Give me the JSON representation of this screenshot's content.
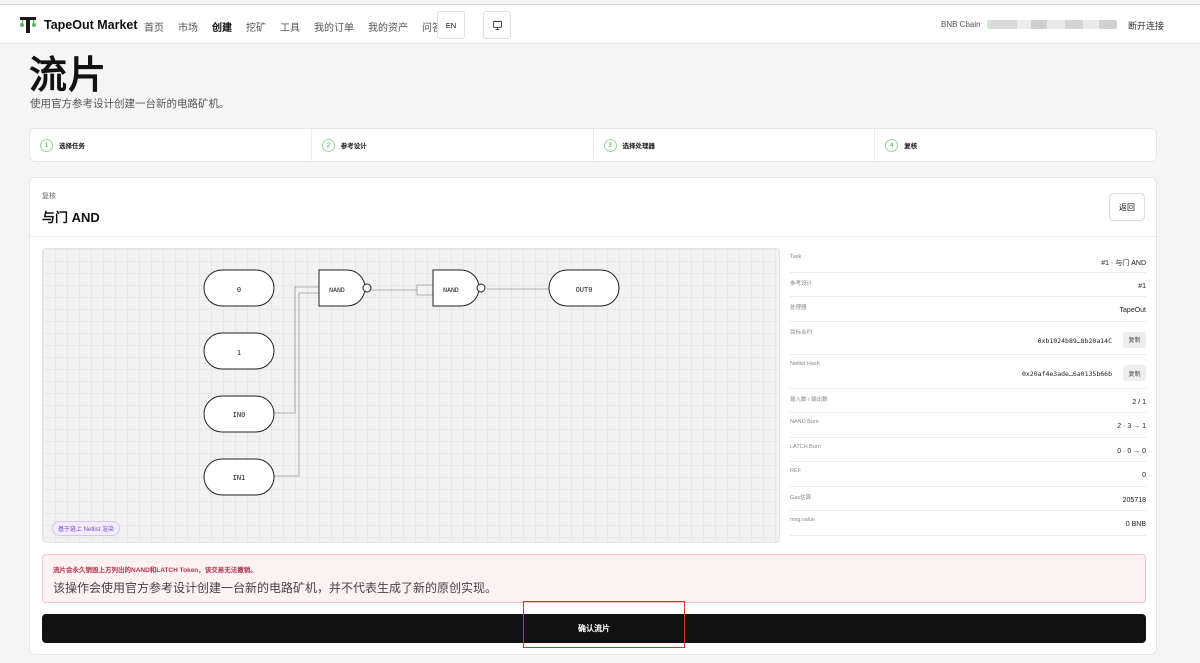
{
  "header": {
    "brand": "TapeOut Market",
    "nav": [
      "首页",
      "市场",
      "创建",
      "挖矿",
      "工具",
      "我的订单",
      "我的资产",
      "问答"
    ],
    "active_nav": "创建",
    "lang_label": "EN",
    "chain_label": "BNB Chain",
    "disconnect_label": "断开连接"
  },
  "page": {
    "title": "流片",
    "subtitle": "使用官方参考设计创建一台新的电路矿机。"
  },
  "steps": [
    {
      "num": "1",
      "label": "选择任务"
    },
    {
      "num": "2",
      "label": "参考设计"
    },
    {
      "num": "3",
      "label": "选择处理器"
    },
    {
      "num": "4",
      "label": "复核"
    }
  ],
  "review": {
    "kicker": "复核",
    "title": "与门 AND",
    "back_label": "返回"
  },
  "circuit": {
    "nodes": [
      {
        "id": "in-0",
        "label": "0",
        "type": "io"
      },
      {
        "id": "in-1",
        "label": "1",
        "type": "io"
      },
      {
        "id": "in-IN0",
        "label": "IN0",
        "type": "io"
      },
      {
        "id": "in-IN1",
        "label": "IN1",
        "type": "io"
      },
      {
        "id": "gate-1",
        "label": "NAND",
        "type": "nand"
      },
      {
        "id": "gate-2",
        "label": "NAND",
        "type": "nand"
      },
      {
        "id": "out-OUT0",
        "label": "OUT0",
        "type": "io"
      }
    ],
    "badge": "基于链上 Netlist 渲染"
  },
  "details": {
    "rows": [
      {
        "key": "Task",
        "value": "#1 · 与门 AND"
      },
      {
        "key": "参考设计",
        "value": "#1"
      },
      {
        "key": "处理器",
        "value": "TapeOut"
      },
      {
        "key": "目标合约",
        "value": "0xb1024b89…8b20a14C",
        "copy": "复制"
      },
      {
        "key": "Netlist Hash",
        "value": "0x20af4e3ade…6a0135b66b",
        "copy": "复制"
      },
      {
        "key": "输入数 / 输出数",
        "value": "2 / 1"
      },
      {
        "key": "NAND Burn",
        "value": "2 · 3 → 1"
      },
      {
        "key": "LATCH Burn",
        "value": "0 · 0 → 0"
      },
      {
        "key": "REF",
        "value": "0"
      },
      {
        "key": "Gas估算",
        "value": "205718"
      },
      {
        "key": "msg.value",
        "value": "0 BNB"
      }
    ]
  },
  "warning": {
    "title": "流片会永久销毁上方列出的NAND和LATCH Token，该交易无法撤销。",
    "body": "该操作会使用官方参考设计创建一台新的电路矿机，并不代表生成了新的原创实现。"
  },
  "confirm_label": "确认流片",
  "colors": {
    "accent_green": "#4a9e4a",
    "warning_text": "#b0364a",
    "confirm_bg": "#111111",
    "highlight": "#d9312b"
  }
}
